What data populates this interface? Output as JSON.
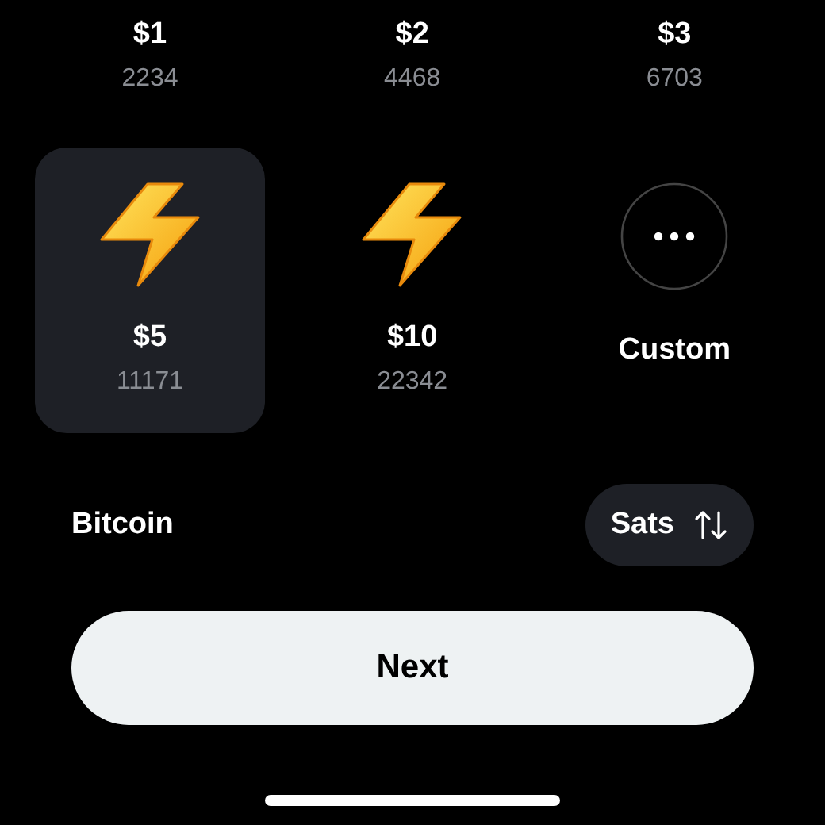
{
  "amounts": [
    {
      "kind": "partial",
      "label": "$1",
      "sats": "2234",
      "selected": false
    },
    {
      "kind": "partial",
      "label": "$2",
      "sats": "4468",
      "selected": false
    },
    {
      "kind": "partial",
      "label": "$3",
      "sats": "6703",
      "selected": false
    },
    {
      "kind": "amount",
      "label": "$5",
      "sats": "11171",
      "selected": true
    },
    {
      "kind": "amount",
      "label": "$10",
      "sats": "22342",
      "selected": false
    },
    {
      "kind": "custom",
      "label": "Custom",
      "selected": false
    }
  ],
  "currency": {
    "label": "Bitcoin",
    "unit": "Sats"
  },
  "next_button": "Next"
}
